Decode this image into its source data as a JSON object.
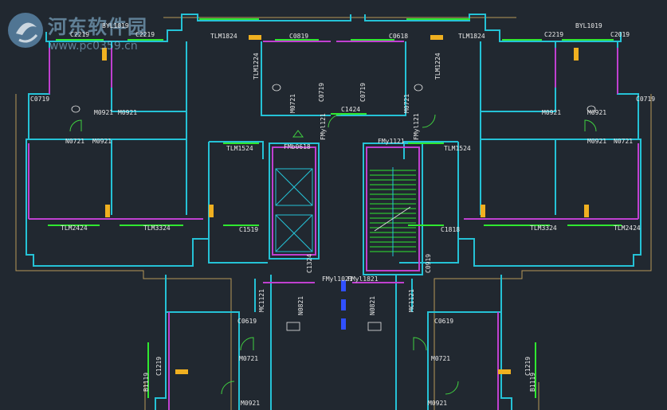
{
  "watermark": {
    "title": "河东软件园",
    "url": "www.pc0359.cn"
  },
  "colors": {
    "background": "#212830",
    "wall": "#25c2d6",
    "partition": "#c040d0",
    "window": "#30e830",
    "door": "#40d040",
    "dim": "#b89858",
    "label": "#e8e8e8"
  },
  "labels": [
    {
      "name": "room-tag",
      "text": "BYL1019"
    },
    {
      "name": "room-tag",
      "text": "C2219"
    },
    {
      "name": "room-tag",
      "text": "C2219"
    },
    {
      "name": "room-tag",
      "text": "TLM1824"
    },
    {
      "name": "room-tag",
      "text": "C0819"
    },
    {
      "name": "room-tag",
      "text": "C0618"
    },
    {
      "name": "room-tag",
      "text": "TLM1824"
    },
    {
      "name": "room-tag",
      "text": "BYL1019"
    },
    {
      "name": "room-tag",
      "text": "C2219"
    },
    {
      "name": "room-tag",
      "text": "C2019"
    },
    {
      "name": "room-tag",
      "text": "C0719"
    },
    {
      "name": "room-tag",
      "text": "C0719"
    },
    {
      "name": "room-tag",
      "text": "M0921"
    },
    {
      "name": "room-tag",
      "text": "M0921"
    },
    {
      "name": "room-tag",
      "text": "M0921"
    },
    {
      "name": "room-tag",
      "text": "M0921"
    },
    {
      "name": "room-tag",
      "text": "C1424"
    },
    {
      "name": "room-tag",
      "text": "N0721"
    },
    {
      "name": "room-tag",
      "text": "M0921"
    },
    {
      "name": "room-tag",
      "text": "M0921"
    },
    {
      "name": "room-tag",
      "text": "N0721"
    },
    {
      "name": "room-tag",
      "text": "FMb0618"
    },
    {
      "name": "room-tag",
      "text": "FMy1121"
    },
    {
      "name": "room-tag",
      "text": "TLM1524"
    },
    {
      "name": "room-tag",
      "text": "TLM1524"
    },
    {
      "name": "room-tag",
      "text": "TLM2424"
    },
    {
      "name": "room-tag",
      "text": "TLM3324"
    },
    {
      "name": "room-tag",
      "text": "C1519"
    },
    {
      "name": "room-tag",
      "text": "C1818"
    },
    {
      "name": "room-tag",
      "text": "TLM3324"
    },
    {
      "name": "room-tag",
      "text": "TLM2424"
    },
    {
      "name": "room-tag",
      "text": "FMyl1021"
    },
    {
      "name": "room-tag",
      "text": "FMyl1821"
    },
    {
      "name": "room-tag",
      "text": "C0619"
    },
    {
      "name": "room-tag",
      "text": "C0619"
    },
    {
      "name": "room-tag",
      "text": "M0721"
    },
    {
      "name": "room-tag",
      "text": "M0721"
    },
    {
      "name": "room-tag",
      "text": "M0921"
    },
    {
      "name": "room-tag",
      "text": "M0921"
    },
    {
      "name": "room-tag",
      "text": "TLM1224"
    },
    {
      "name": "room-tag",
      "text": "TLM1224"
    },
    {
      "name": "room-tag",
      "text": "M0721"
    },
    {
      "name": "room-tag",
      "text": "M0721"
    },
    {
      "name": "room-tag",
      "text": "FMyl121"
    },
    {
      "name": "room-tag",
      "text": "FMyl121"
    },
    {
      "name": "room-tag",
      "text": "C1324"
    },
    {
      "name": "room-tag",
      "text": "C0919"
    },
    {
      "name": "room-tag",
      "text": "MC1121"
    },
    {
      "name": "room-tag",
      "text": "MC1121"
    },
    {
      "name": "room-tag",
      "text": "N0821"
    },
    {
      "name": "room-tag",
      "text": "N0821"
    },
    {
      "name": "room-tag",
      "text": "C1219"
    },
    {
      "name": "room-tag",
      "text": "C1219"
    },
    {
      "name": "room-tag",
      "text": "B1119"
    },
    {
      "name": "room-tag",
      "text": "B1119"
    },
    {
      "name": "room-tag",
      "text": "C0719"
    },
    {
      "name": "room-tag",
      "text": "C0719"
    }
  ]
}
